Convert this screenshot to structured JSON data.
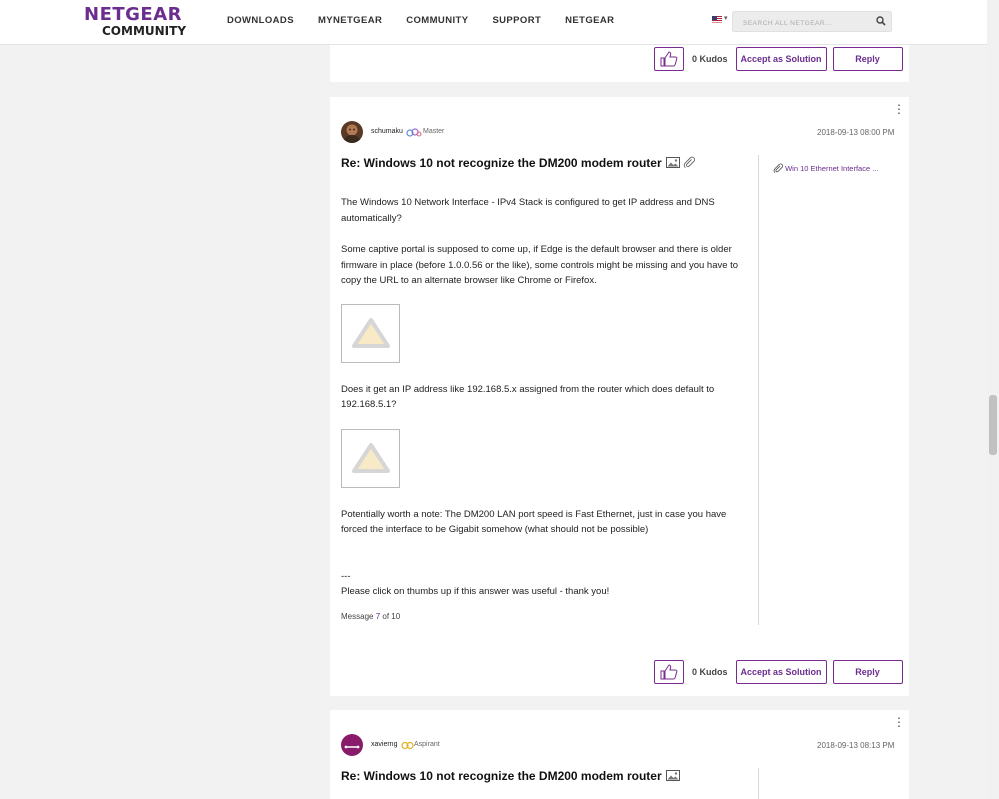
{
  "header": {
    "logo_line1": "NETGEAR",
    "logo_line2": "COMMUNITY",
    "nav": [
      "DOWNLOADS",
      "MYNETGEAR",
      "COMMUNITY",
      "SUPPORT",
      "NETGEAR"
    ],
    "search_placeholder": "SEARCH ALL NETGEAR..."
  },
  "prev_post": {
    "kudos": "0 Kudos",
    "accept_label": "Accept as Solution",
    "reply_label": "Reply"
  },
  "post7": {
    "author": "schumaku",
    "rank": "Master",
    "date": "2018-09-13 08:00 PM",
    "subject": "Re: Windows 10 not recognize the DM200 modem router",
    "para1": "The Windows 10 Network Interface - IPv4 Stack is configured to get IP address and DNS automatically?",
    "para2": "Some captive portal is supposed to come up, if Edge is the default browser and there is older firmware in place (before 1.0.0.56 or the like), some controls might be missing and you have to copy the URL to an alternate browser like Chrome or Firefox.",
    "para3": "Does it get an IP address like 192.168.5.x assigned from the router which does default to 192.168.5.1?",
    "para4": "Potentially worth a note: The DM200 LAN port speed is Fast Ethernet, just in case you have forced the interface to be Gigabit somehow (what should not be possible)",
    "signature_sep": "---",
    "signature": "Please click on thumbs up if this answer was useful - thank you!",
    "message_prefix": "Message",
    "message_num": "7",
    "message_suffix": "of 10",
    "attachment": "Win 10 Ethernet Interface ...",
    "kudos": "0 Kudos",
    "accept_label": "Accept as Solution",
    "reply_label": "Reply"
  },
  "post8": {
    "author": "xavierng",
    "rank": "Aspirant",
    "date": "2018-09-13 08:13 PM",
    "subject": "Re: Windows 10 not recognize the DM200 modem router"
  },
  "colors": {
    "brand": "#6b2d8f",
    "page_bg": "#f2f2f2"
  }
}
